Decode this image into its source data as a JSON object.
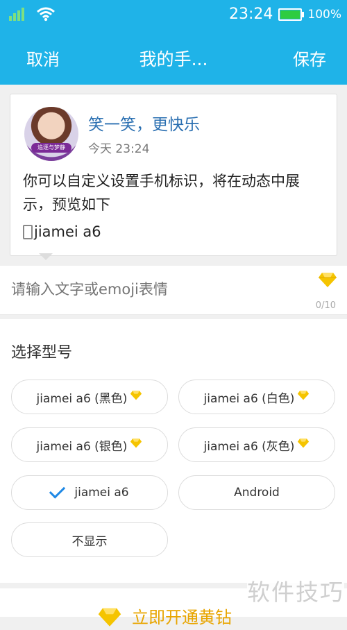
{
  "status_bar": {
    "time": "23:24",
    "battery_percent": "100%",
    "battery_level": 1.0,
    "icons": [
      "signal-icon",
      "wifi-icon",
      "battery-icon"
    ]
  },
  "nav": {
    "cancel_label": "取消",
    "title": "我的手...",
    "save_label": "保存"
  },
  "preview": {
    "user_name": "笑一笑，更快乐",
    "time": "今天 23:24",
    "avatar_tag": "追逐与梦静",
    "body": "你可以自定义设置手机标识，将在动态中展示，预览如下",
    "device_label": "jiamei a6"
  },
  "input": {
    "placeholder": "请输入文字或emoji表情",
    "count": "0/10"
  },
  "models": {
    "title": "选择型号",
    "options": [
      {
        "label": "jiamei a6 (黑色)",
        "premium": true,
        "selected": false
      },
      {
        "label": "jiamei a6 (白色)",
        "premium": true,
        "selected": false
      },
      {
        "label": "jiamei a6 (银色)",
        "premium": true,
        "selected": false
      },
      {
        "label": "jiamei a6 (灰色)",
        "premium": true,
        "selected": false
      },
      {
        "label": "jiamei a6",
        "premium": false,
        "selected": true
      },
      {
        "label": "Android",
        "premium": false,
        "selected": false
      },
      {
        "label": "不显示",
        "premium": false,
        "selected": false
      }
    ]
  },
  "bottom": {
    "cta": "立即开通黄钻"
  },
  "watermark": "软件技巧",
  "colors": {
    "header": "#1fb3e8",
    "gem": "#f5c400",
    "check": "#1e88e5",
    "name": "#2a6fb1"
  }
}
